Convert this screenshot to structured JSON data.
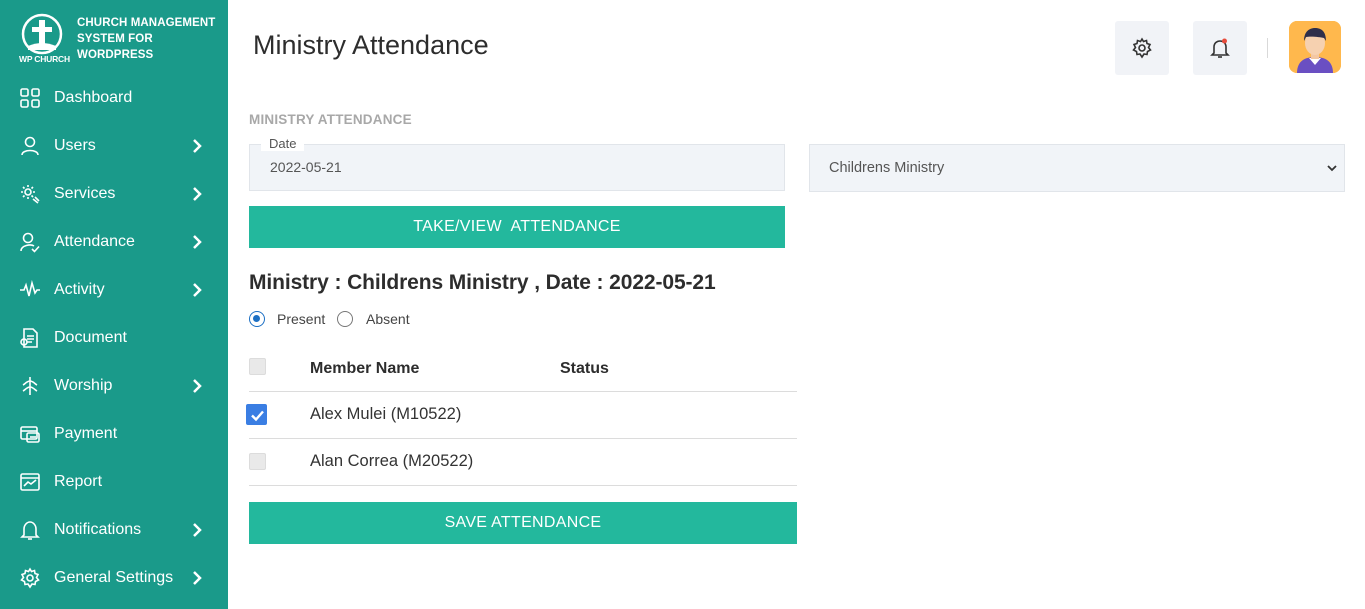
{
  "brand": {
    "name_lines": [
      "CHURCH MANAGEMENT",
      "SYSTEM FOR",
      "WORDPRESS"
    ],
    "logo_label": "WP CHURCH",
    "color": "#1a9a8a"
  },
  "sidebar": {
    "items": [
      {
        "label": "Dashboard",
        "icon": "dashboard-icon",
        "has_submenu": false
      },
      {
        "label": "Users",
        "icon": "user-icon",
        "has_submenu": true
      },
      {
        "label": "Services",
        "icon": "services-icon",
        "has_submenu": true
      },
      {
        "label": "Attendance",
        "icon": "attendance-icon",
        "has_submenu": true
      },
      {
        "label": "Activity",
        "icon": "activity-icon",
        "has_submenu": true
      },
      {
        "label": "Document",
        "icon": "document-icon",
        "has_submenu": false
      },
      {
        "label": "Worship",
        "icon": "worship-icon",
        "has_submenu": true
      },
      {
        "label": "Payment",
        "icon": "payment-icon",
        "has_submenu": false
      },
      {
        "label": "Report",
        "icon": "report-icon",
        "has_submenu": false
      },
      {
        "label": "Notifications",
        "icon": "bell-icon",
        "has_submenu": true
      },
      {
        "label": "General Settings",
        "icon": "gear-icon",
        "has_submenu": true
      }
    ]
  },
  "header": {
    "title": "Ministry Attendance",
    "settings_icon": "gear-icon",
    "notification_icon": "bell-icon",
    "avatar_icon": "user-avatar-icon"
  },
  "form": {
    "section_label": "MINISTRY ATTENDANCE",
    "date_label": "Date",
    "date_value": "2022-05-21",
    "ministry_selected": "Childrens Ministry",
    "take_button": "TAKE/VIEW  ATTENDANCE"
  },
  "attendance": {
    "heading": "Ministry : Childrens Ministry , Date : 2022-05-21",
    "radio_present": "Present",
    "radio_absent": "Absent",
    "selected_radio": "Present",
    "columns": [
      "Member Name",
      "Status"
    ],
    "members": [
      {
        "name": "Alex Mulei (M10522)",
        "checked": true,
        "status": ""
      },
      {
        "name": "Alan Correa (M20522)",
        "checked": false,
        "status": ""
      }
    ],
    "save_button": "SAVE ATTENDANCE"
  },
  "colors": {
    "sidebar": "#1a9a8a",
    "accent_button": "#23b89d",
    "checkbox_checked": "#3a7ee3",
    "radio_checked": "#1d70c4",
    "notification_dot": "#e74c3c"
  }
}
